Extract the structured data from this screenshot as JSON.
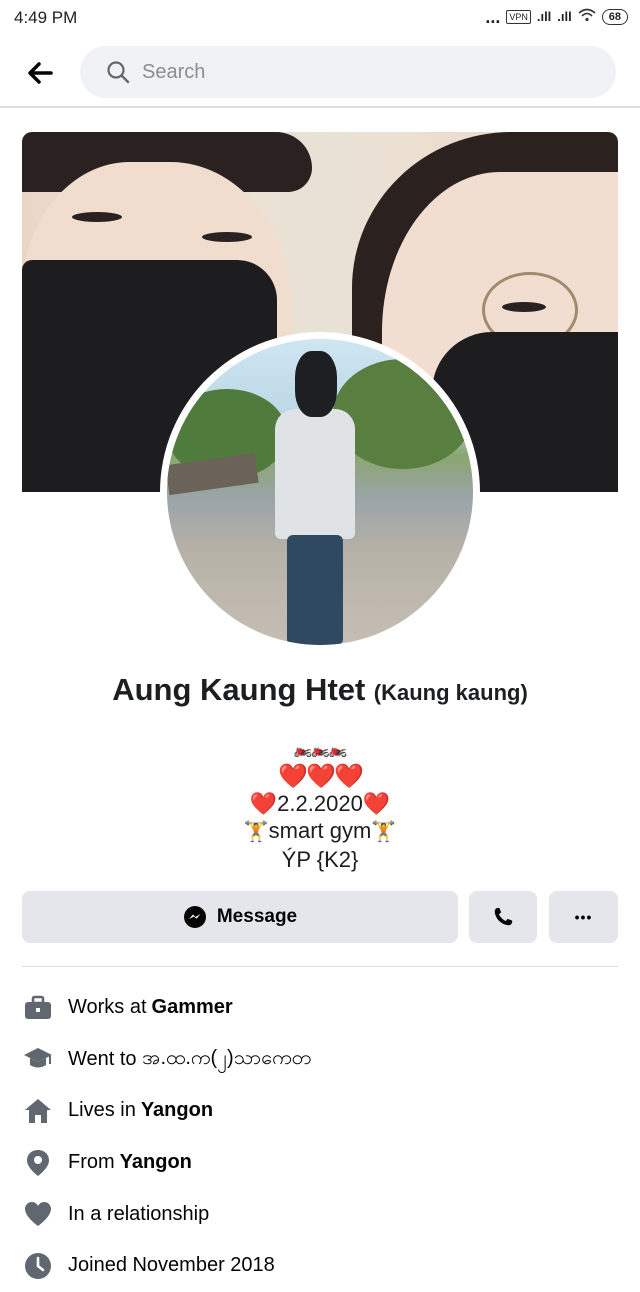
{
  "status_bar": {
    "time": "4:49 PM",
    "dots": "...",
    "vpn": "VPN",
    "signal1": ".ıll",
    "signal2": ".ıll",
    "battery": "68"
  },
  "search": {
    "placeholder": "Search"
  },
  "profile": {
    "name": "Aung Kaung Htet",
    "alternate_name": "(Kaung kaung)",
    "bio": {
      "line1": "🏍️🏍️🏍️",
      "line2": "❤️❤️❤️",
      "line3_heart_left": "❤️",
      "line3_date": "2.2.2020",
      "line3_heart_right": "❤️",
      "line4_icon_left": "🏋",
      "line4_text": "smart gym",
      "line4_icon_right": "🏋",
      "line5": "ÝP {K2}"
    }
  },
  "actions": {
    "message_label": "Message",
    "more_label": "•••"
  },
  "details": [
    {
      "icon": "briefcase-icon",
      "prefix": "Works at",
      "value": "Gammer"
    },
    {
      "icon": "graduation-cap-icon",
      "prefix": "Went to",
      "value": "",
      "plain_value": "အ.ထ.က(၂)သာကေတ"
    },
    {
      "icon": "home-icon",
      "prefix": "Lives in",
      "value": "Yangon"
    },
    {
      "icon": "location-pin-icon",
      "prefix": "From",
      "value": "Yangon"
    },
    {
      "icon": "heart-icon",
      "prefix": "In a relationship",
      "value": ""
    },
    {
      "icon": "clock-icon",
      "prefix": "Joined November 2018",
      "value": ""
    }
  ],
  "colors": {
    "button_bg": "#e4e6eb",
    "icon_gray": "#606770",
    "heart_red": "#e0232e"
  }
}
